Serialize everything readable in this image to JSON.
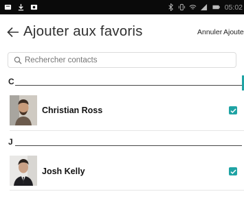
{
  "status_bar": {
    "time": "05:02",
    "left_icons": [
      "message-icon",
      "download-icon",
      "photo-icon"
    ],
    "right_icons": [
      "bluetooth-icon",
      "vibrate-icon",
      "wifi-icon",
      "signal-icon",
      "battery-icon"
    ]
  },
  "header": {
    "title": "Ajouter aux favoris",
    "cancel_label": "Annuler",
    "add_label": "Ajouter"
  },
  "search": {
    "placeholder": "Rechercher contacts",
    "value": ""
  },
  "sections": [
    {
      "letter": "C",
      "contacts": [
        {
          "name": "Christian Ross",
          "checked": true
        }
      ]
    },
    {
      "letter": "J",
      "contacts": [
        {
          "name": "Josh Kelly",
          "checked": true
        }
      ]
    }
  ],
  "colors": {
    "accent": "#1fa3a4",
    "status_bar": "#0a0a0a"
  }
}
